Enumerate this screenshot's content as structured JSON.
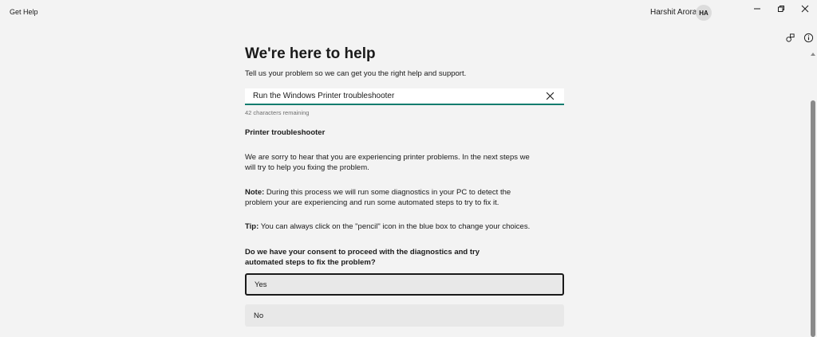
{
  "window": {
    "title": "Get Help",
    "user_name": "Harshit Arora",
    "avatar_initials": "HA"
  },
  "main": {
    "title": "We're here to help",
    "subtitle": "Tell us your problem so we can get you the right help and support.",
    "search": {
      "value": "Run the Windows Printer troubleshooter",
      "char_count": "42 characters remaining"
    },
    "section_title": "Printer troubleshooter",
    "paragraph1": "We are sorry to hear that you are experiencing printer problems. In the next steps we will try to help you fixing the problem.",
    "note_label": "Note:",
    "note_text": " During this process we will run some diagnostics in your PC to detect the problem your are experiencing and run some automated steps to try to fix it.",
    "tip_label": "Tip:",
    "tip_text": " You can always click on the \"pencil\" icon in the blue box to change your choices.",
    "question": "Do we have your consent to proceed with the diagnostics and try automated steps to fix the problem?",
    "choices": [
      {
        "label": "Yes",
        "selected": true
      },
      {
        "label": "No",
        "selected": false
      }
    ]
  },
  "colors": {
    "accent_underline": "#107c6e",
    "background": "#f3f3f3"
  }
}
